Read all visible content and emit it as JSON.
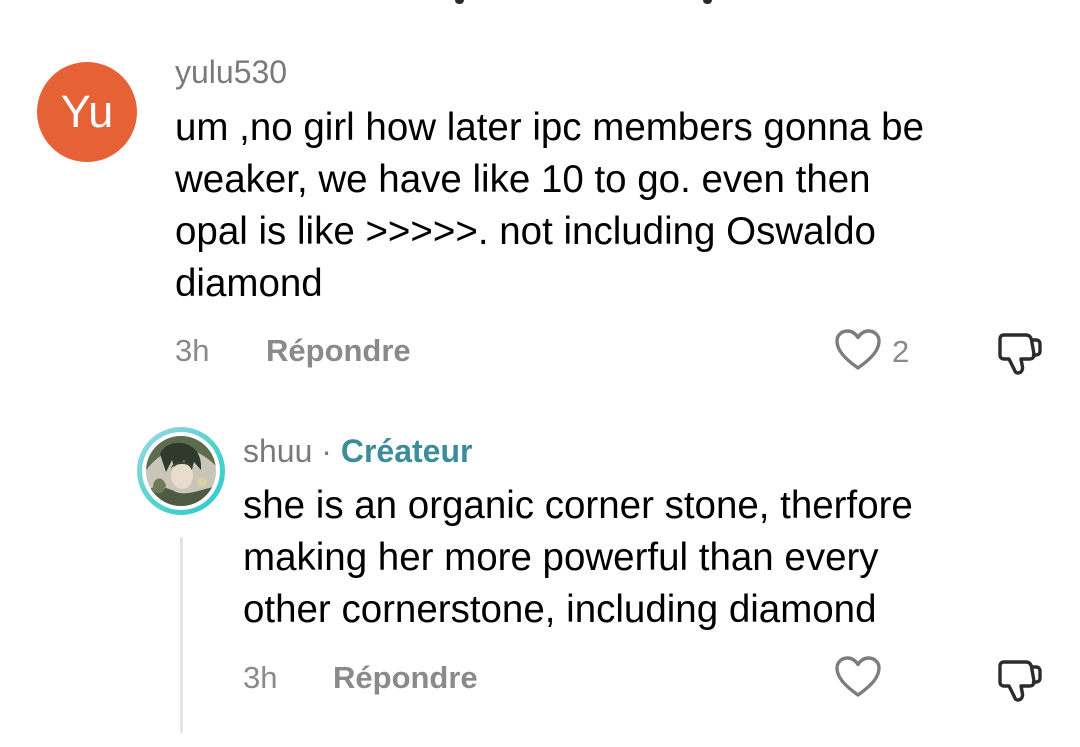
{
  "comments": [
    {
      "avatar_initials": "Yu",
      "avatar_color": "#e66236",
      "username": "yulu530",
      "text": "um ,no girl how later ipc members gonna be\nweaker, we have like 10 to go. even then\nopal is like >>>>>. not including Oswaldo\ndiamond",
      "time": "3h",
      "reply_label": "Répondre",
      "like_count": "2",
      "like_icon": "heart-outline-icon",
      "dislike_icon": "thumbs-down-outline-icon"
    }
  ],
  "reply": {
    "username": "shuu",
    "separator": "·",
    "badge": "Créateur",
    "badge_color": "#3c8c9a",
    "text": "she is an organic corner stone, therfore\nmaking her more powerful than every\nother cornerstone, including diamond",
    "time": "3h",
    "reply_label": "Répondre",
    "like_icon": "heart-outline-icon",
    "dislike_icon": "thumbs-down-outline-icon",
    "avatar_ring_colors": [
      "#9fd7ea",
      "#52d3c9",
      "#2bc8d8"
    ]
  }
}
